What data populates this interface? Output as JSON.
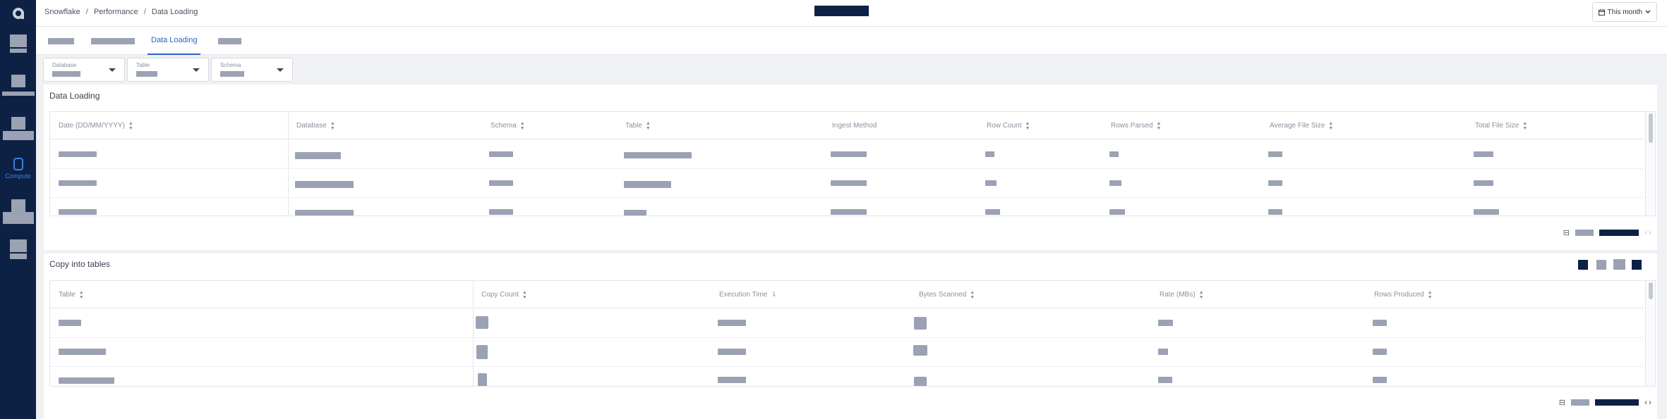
{
  "sidebar": {
    "logo_letter": "a",
    "items": [
      {
        "name": "sidebar-item-1"
      },
      {
        "name": "sidebar-item-2"
      },
      {
        "name": "sidebar-item-3"
      },
      {
        "name": "sidebar-item-compute",
        "label": "Compute",
        "active": true
      },
      {
        "name": "sidebar-item-5"
      },
      {
        "name": "sidebar-item-6"
      }
    ]
  },
  "breadcrumb": {
    "items": [
      "Snowflake",
      "Performance",
      "Data Loading"
    ],
    "separator": "/"
  },
  "header": {
    "date_range_label": "This month",
    "calendar_icon": "calendar-icon",
    "chevron_icon": "chevron-down-icon"
  },
  "tabs": {
    "active_label": "Data Loading"
  },
  "filters": [
    {
      "label": "Database"
    },
    {
      "label": "Table"
    },
    {
      "label": "Schema"
    }
  ],
  "data_loading": {
    "title": "Data Loading",
    "columns": [
      "Date (DD/MM/YYYY)",
      "Database",
      "Schema",
      "Table",
      "Ingest Method",
      "Row Count",
      "Rows Parsed",
      "Average File Size",
      "Total File Size"
    ],
    "sortable": [
      true,
      true,
      true,
      true,
      false,
      true,
      true,
      true,
      true
    ]
  },
  "copy_into_tables": {
    "title": "Copy into tables",
    "columns": [
      "Table",
      "Copy Count",
      "Execution Time",
      "Bytes Scanned",
      "Rate (MBs)",
      "Rows Produced"
    ],
    "sort_icons": [
      "sort-icon",
      "sort-icon",
      "sort-desc-icon",
      "sort-icon",
      "sort-icon",
      "sort-icon"
    ]
  },
  "colors": {
    "sidebar_bg": "#0d2145",
    "accent": "#2c64c4",
    "redaction_grey": "#9aa2b3",
    "redaction_dark": "#0d2145"
  }
}
